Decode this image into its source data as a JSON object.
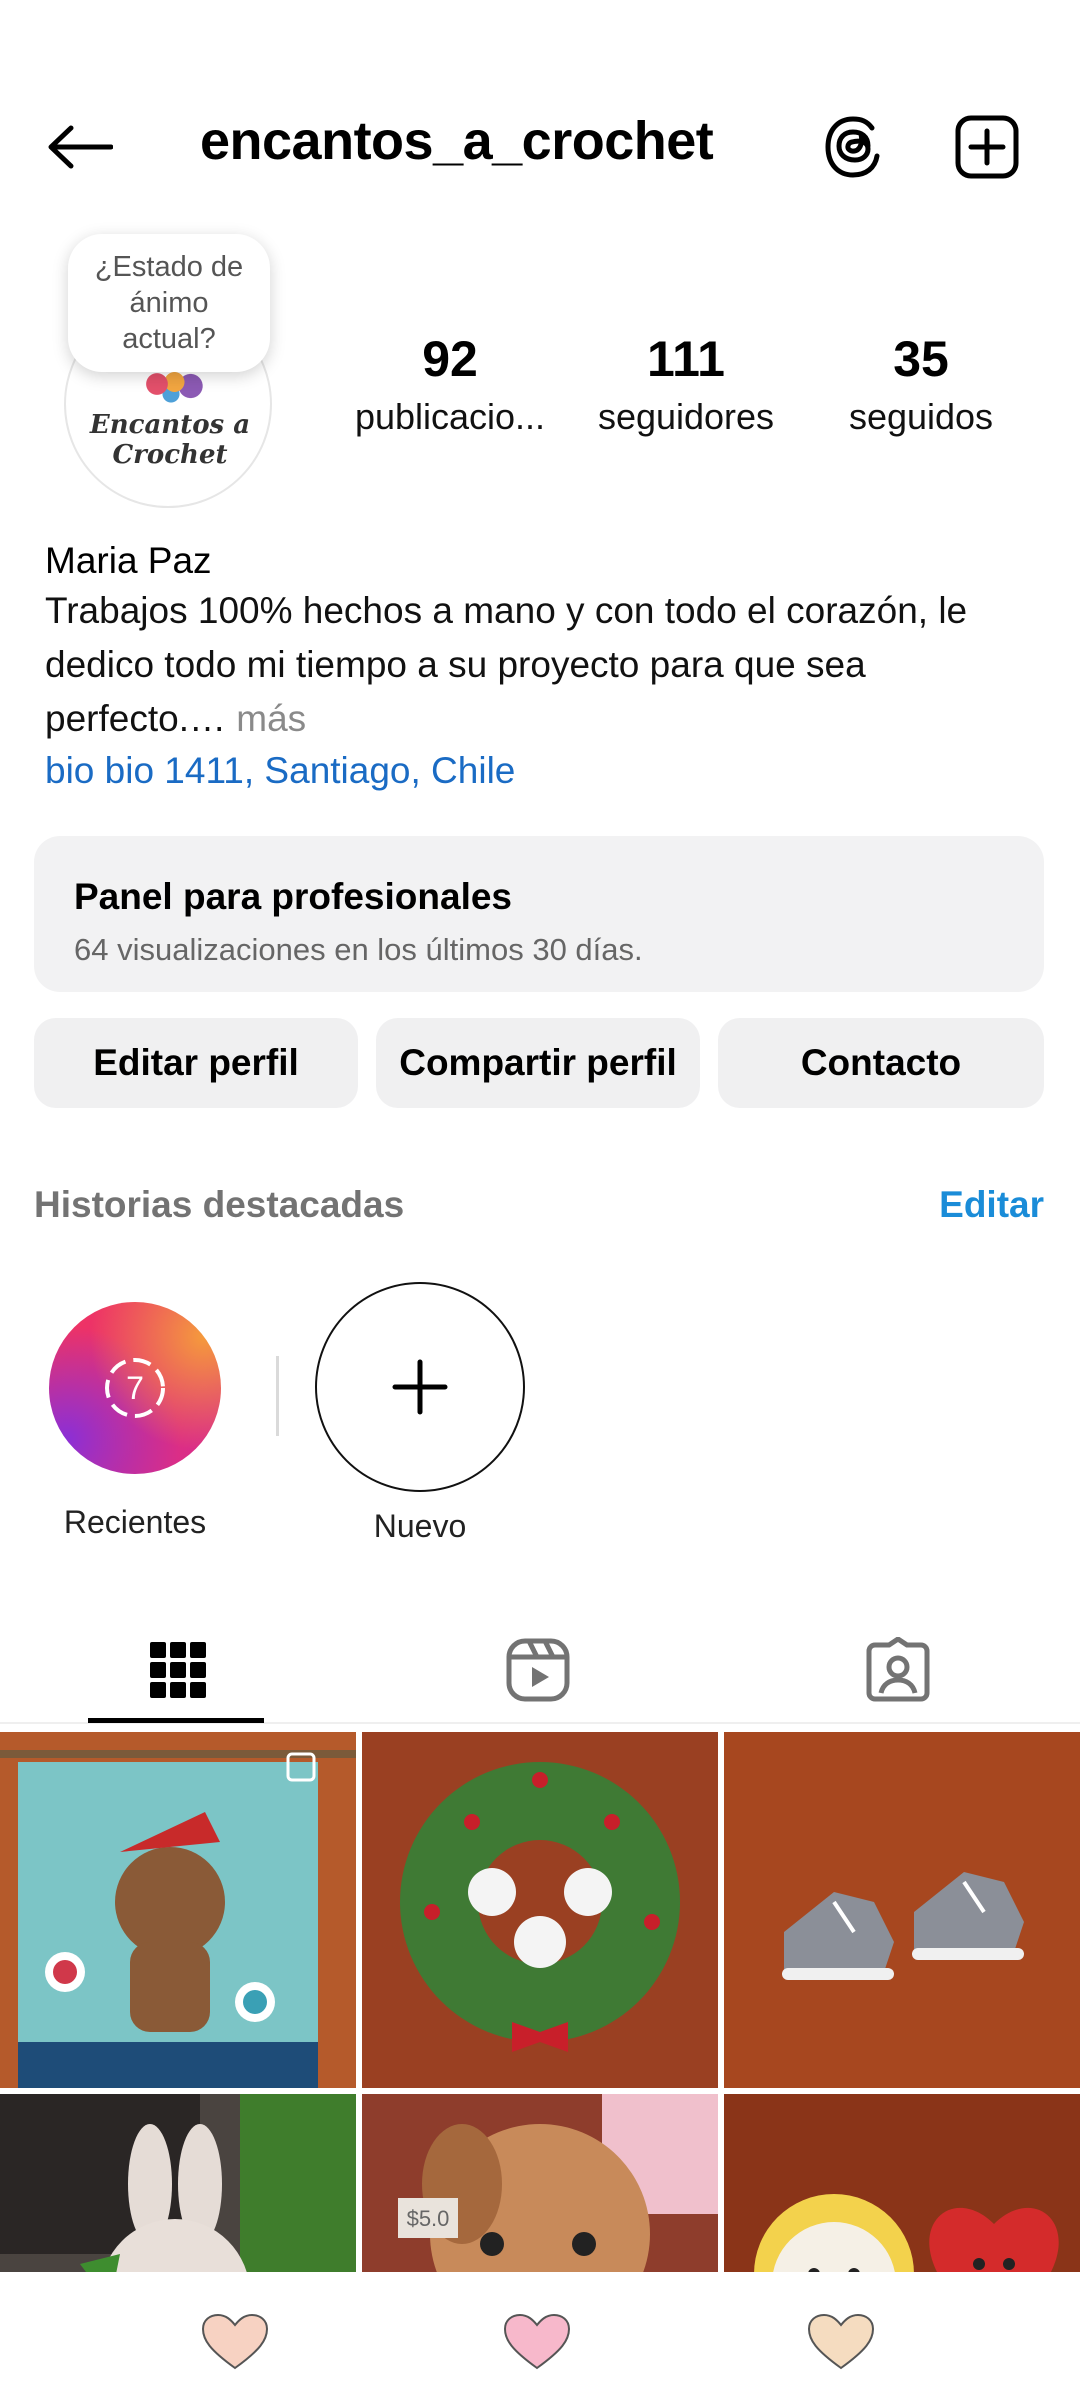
{
  "header": {
    "username": "encantos_a_crochet"
  },
  "profile": {
    "mood_bubble": "¿Estado de ánimo actual?",
    "avatar_text": "Encantos a Crochet",
    "stats": {
      "posts": {
        "value": "92",
        "label": "publicacio..."
      },
      "followers": {
        "value": "111",
        "label": "seguidores"
      },
      "following": {
        "value": "35",
        "label": "seguidos"
      }
    },
    "name": "Maria Paz",
    "bio": "Trabajos 100% hechos a mano y con todo el corazón, le dedico todo mi tiempo a su proyecto para que sea perfecto.…",
    "bio_more": " más",
    "location": "bio bio 1411, Santiago, Chile"
  },
  "pro_panel": {
    "title": "Panel para profesionales",
    "subtitle": "64 visualizaciones en los últimos 30 días."
  },
  "actions": {
    "edit": "Editar perfil",
    "share": "Compartir perfil",
    "contact": "Contacto"
  },
  "highlights": {
    "title": "Historias destacadas",
    "edit": "Editar",
    "items": [
      {
        "label": "Recientes",
        "count": "7"
      },
      {
        "label": "Nuevo"
      }
    ]
  },
  "tabs": [
    {
      "icon": "grid-icon"
    },
    {
      "icon": "reels-icon"
    },
    {
      "icon": "tagged-icon"
    }
  ],
  "posts": [
    {
      "label": ""
    },
    {
      "label": ""
    },
    {
      "label": ""
    },
    {
      "label": ""
    },
    {
      "label": "$5.0"
    },
    {
      "label": ""
    }
  ],
  "bottom_bar": {
    "colors": [
      "#f7d2c2",
      "#f7b8cb",
      "#f5dcc0"
    ]
  }
}
